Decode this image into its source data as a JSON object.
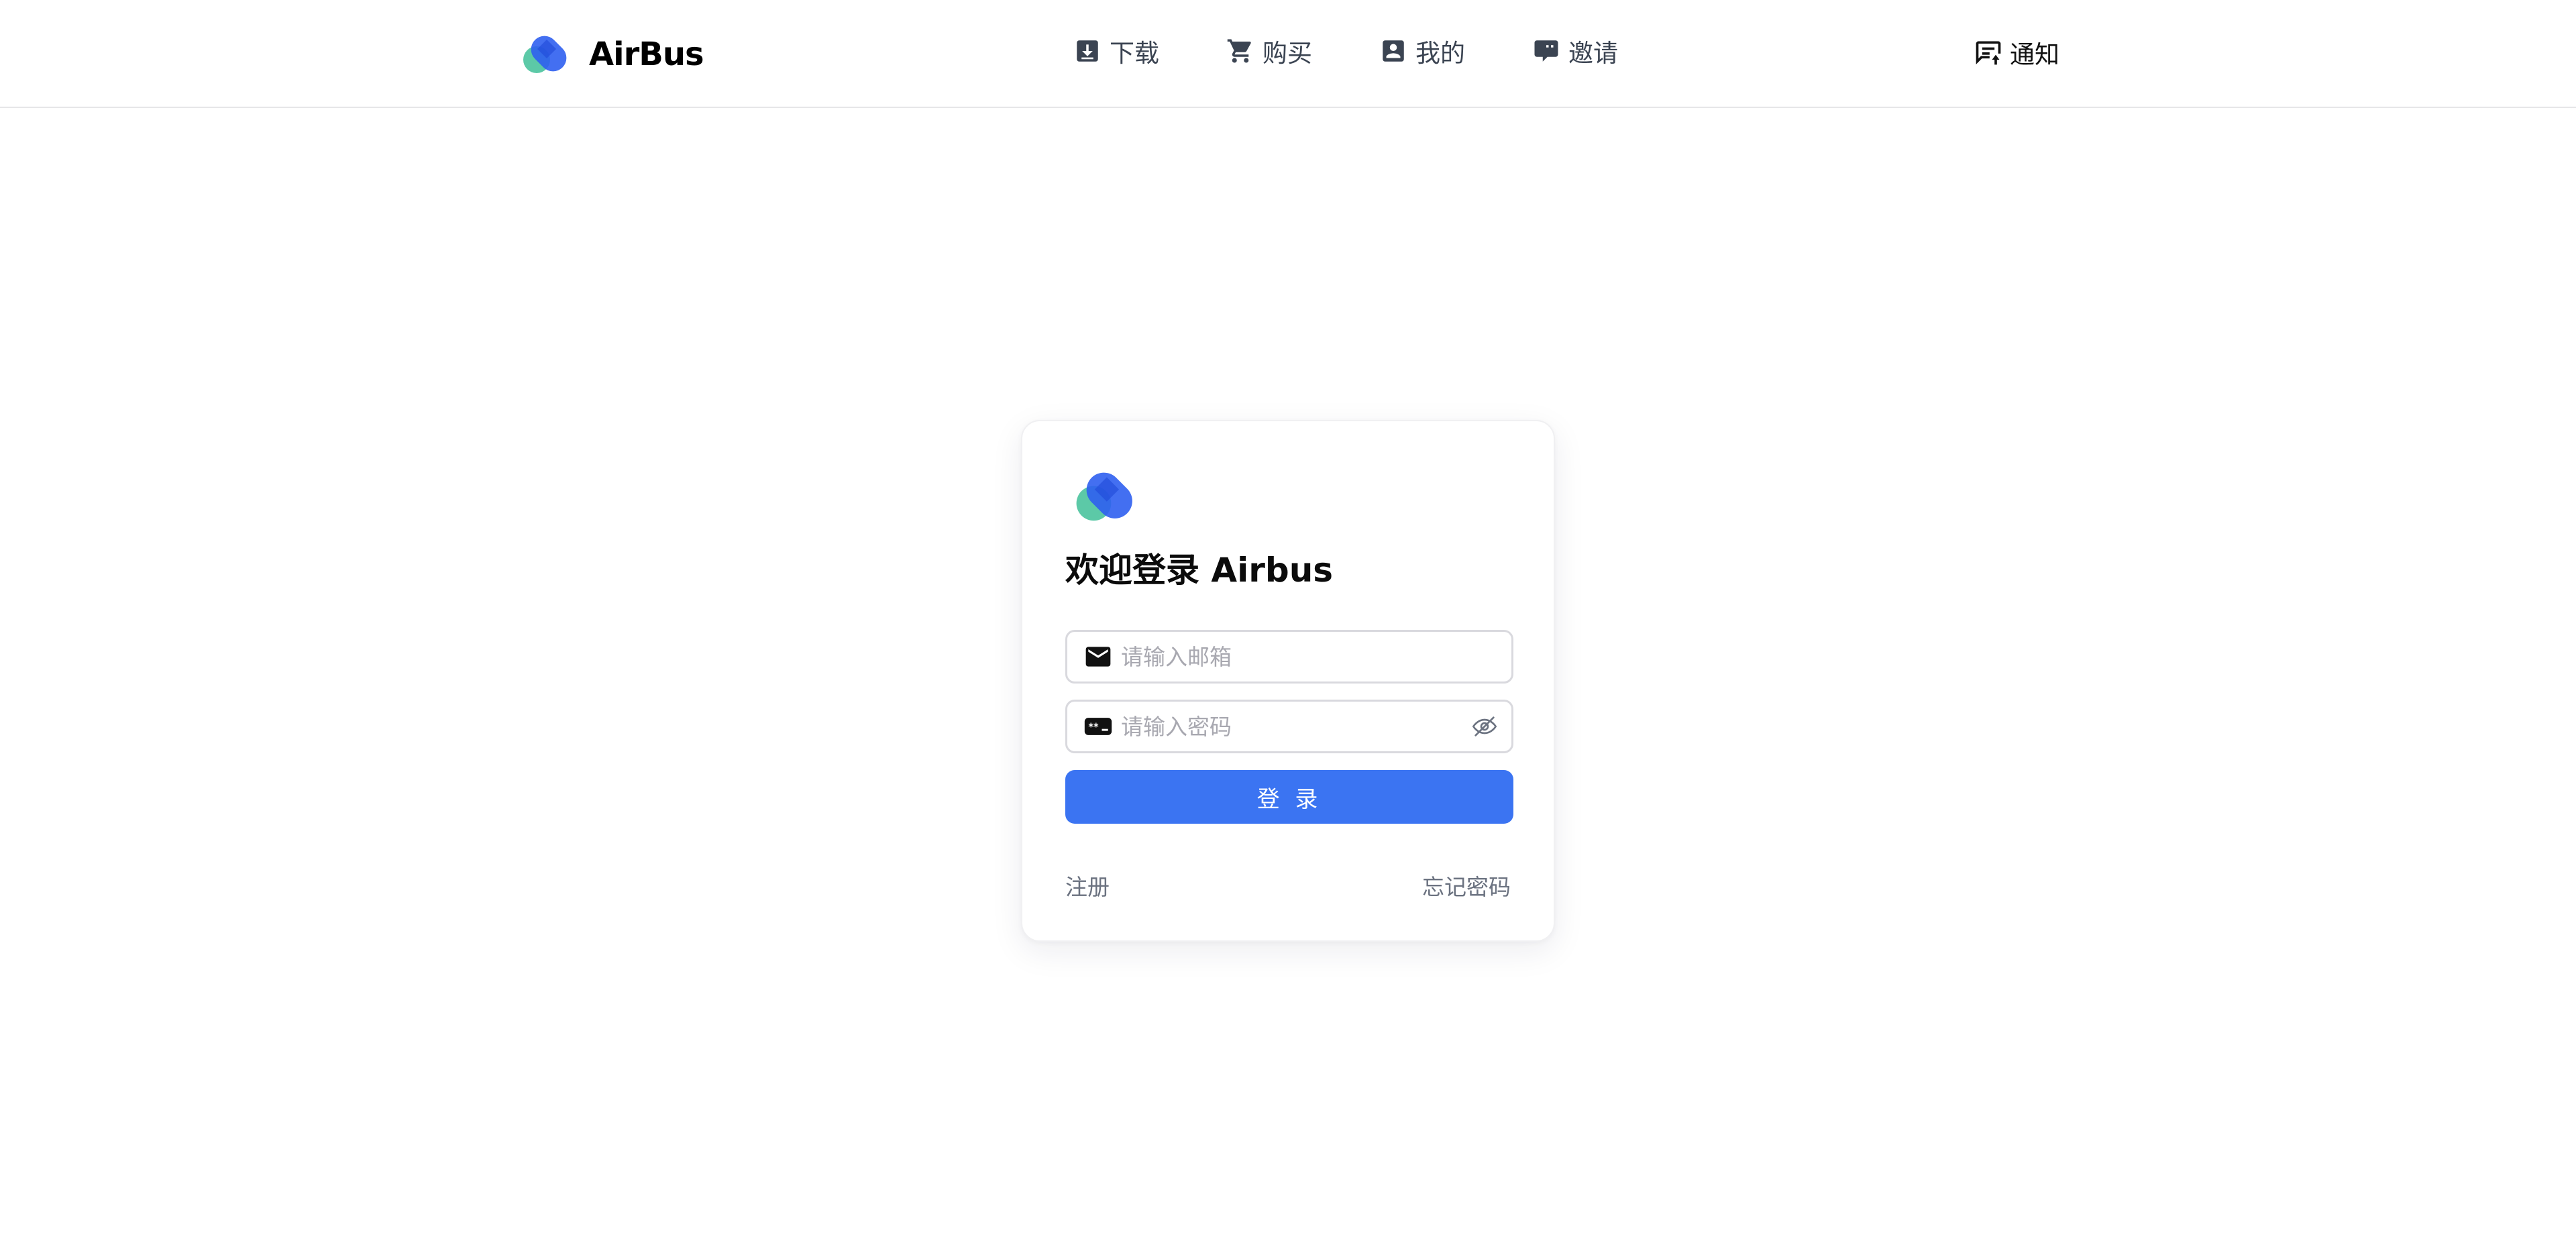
{
  "header": {
    "brand": {
      "name": "AirBus",
      "logo_icon": "airbus-logo-icon"
    },
    "nav": [
      {
        "label": "下载",
        "icon": "download-box-icon"
      },
      {
        "label": "购买",
        "icon": "cart-icon"
      },
      {
        "label": "我的",
        "icon": "account-box-icon"
      },
      {
        "label": "邀请",
        "icon": "chat-bubble-icon"
      }
    ],
    "notify": {
      "label": "通知",
      "icon": "notification-message-icon"
    }
  },
  "login": {
    "logo_icon": "airbus-logo-icon",
    "title": "欢迎登录 Airbus",
    "email": {
      "value": "",
      "placeholder": "请输入邮箱",
      "icon": "email-icon"
    },
    "password": {
      "value": "",
      "placeholder": "请输入密码",
      "icon": "password-icon",
      "toggle_icon": "eye-off-icon"
    },
    "submit_label": "登 录",
    "register_label": "注册",
    "forgot_label": "忘记密码"
  },
  "colors": {
    "accent": "#3b74f2",
    "logo_blue": "#2f5ff0",
    "logo_green": "#5cc9a7",
    "nav_text": "#3b4452",
    "muted_text": "#6b7280",
    "placeholder": "#a8a8b0",
    "border": "#d9d9de"
  }
}
